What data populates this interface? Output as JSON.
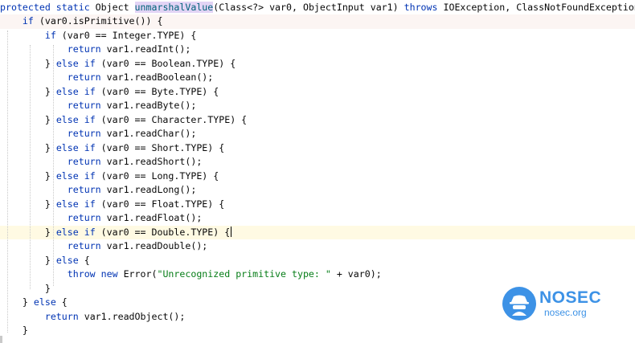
{
  "editor": {
    "lines": [
      {
        "tokens": [
          {
            "t": "protected static ",
            "k": "kw"
          },
          {
            "t": "Object "
          },
          {
            "t": "unmarshalValue",
            "k": "fn hl"
          },
          {
            "t": "(Class<?> var0, ObjectInput var1) "
          },
          {
            "t": "throws ",
            "k": "kw"
          },
          {
            "t": "IOException, ClassNotFoundException {"
          }
        ]
      },
      {
        "tokens": [
          {
            "t": "    "
          },
          {
            "t": "if ",
            "k": "kw"
          },
          {
            "t": "(var0.isPrimitive()) {"
          }
        ]
      },
      {
        "tokens": [
          {
            "t": "        "
          },
          {
            "t": "if ",
            "k": "kw"
          },
          {
            "t": "(var0 == Integer."
          },
          {
            "t": "TYPE"
          },
          {
            "t": ") {"
          }
        ]
      },
      {
        "tokens": [
          {
            "t": "            "
          },
          {
            "t": "return ",
            "k": "kw"
          },
          {
            "t": "var1.readInt();"
          }
        ]
      },
      {
        "tokens": [
          {
            "t": "        } "
          },
          {
            "t": "else if ",
            "k": "kw"
          },
          {
            "t": "(var0 == Boolean.TYPE) {"
          }
        ]
      },
      {
        "tokens": [
          {
            "t": "            "
          },
          {
            "t": "return ",
            "k": "kw"
          },
          {
            "t": "var1.readBoolean();"
          }
        ]
      },
      {
        "tokens": [
          {
            "t": "        } "
          },
          {
            "t": "else if ",
            "k": "kw"
          },
          {
            "t": "(var0 == Byte.TYPE) {"
          }
        ]
      },
      {
        "tokens": [
          {
            "t": "            "
          },
          {
            "t": "return ",
            "k": "kw"
          },
          {
            "t": "var1.readByte();"
          }
        ]
      },
      {
        "tokens": [
          {
            "t": "        } "
          },
          {
            "t": "else if ",
            "k": "kw"
          },
          {
            "t": "(var0 == Character.TYPE) {"
          }
        ]
      },
      {
        "tokens": [
          {
            "t": "            "
          },
          {
            "t": "return ",
            "k": "kw"
          },
          {
            "t": "var1.readChar();"
          }
        ]
      },
      {
        "tokens": [
          {
            "t": "        } "
          },
          {
            "t": "else if ",
            "k": "kw"
          },
          {
            "t": "(var0 == Short.TYPE) {"
          }
        ]
      },
      {
        "tokens": [
          {
            "t": "            "
          },
          {
            "t": "return ",
            "k": "kw"
          },
          {
            "t": "var1.readShort();"
          }
        ]
      },
      {
        "tokens": [
          {
            "t": "        } "
          },
          {
            "t": "else if ",
            "k": "kw"
          },
          {
            "t": "(var0 == Long.TYPE) {"
          }
        ]
      },
      {
        "tokens": [
          {
            "t": "            "
          },
          {
            "t": "return ",
            "k": "kw"
          },
          {
            "t": "var1.readLong();"
          }
        ]
      },
      {
        "tokens": [
          {
            "t": "        } "
          },
          {
            "t": "else if ",
            "k": "kw"
          },
          {
            "t": "(var0 == Float.TYPE) {"
          }
        ]
      },
      {
        "tokens": [
          {
            "t": "            "
          },
          {
            "t": "return ",
            "k": "kw"
          },
          {
            "t": "var1.readFloat();"
          }
        ]
      },
      {
        "tokens": [
          {
            "t": "        } "
          },
          {
            "t": "else if ",
            "k": "kw"
          },
          {
            "t": "(var0 == Double.TYPE) {"
          }
        ],
        "caret": true
      },
      {
        "tokens": [
          {
            "t": "            "
          },
          {
            "t": "return ",
            "k": "kw"
          },
          {
            "t": "var1.readDouble();"
          }
        ]
      },
      {
        "tokens": [
          {
            "t": "        } "
          },
          {
            "t": "else ",
            "k": "kw"
          },
          {
            "t": "{"
          }
        ]
      },
      {
        "tokens": [
          {
            "t": "            "
          },
          {
            "t": "throw new ",
            "k": "kw"
          },
          {
            "t": "Error("
          },
          {
            "t": "\"Unrecognized primitive type: \"",
            "k": "str"
          },
          {
            "t": " + var0);"
          }
        ]
      },
      {
        "tokens": [
          {
            "t": "        }"
          }
        ]
      },
      {
        "tokens": [
          {
            "t": "    } "
          },
          {
            "t": "else ",
            "k": "kw"
          },
          {
            "t": "{"
          }
        ]
      },
      {
        "tokens": [
          {
            "t": "        "
          },
          {
            "t": "return ",
            "k": "kw"
          },
          {
            "t": "var1.readObject();"
          }
        ]
      },
      {
        "tokens": [
          {
            "t": "    }"
          }
        ]
      }
    ]
  },
  "watermark": {
    "title": "NOSEC",
    "subtitle": "nosec.org",
    "icon": "spy-hat-icon",
    "color": "#3d92e6"
  }
}
